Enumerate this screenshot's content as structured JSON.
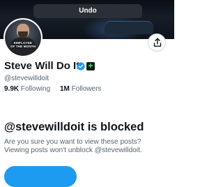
{
  "toast": {
    "undo_label": "Undo"
  },
  "profile": {
    "avatar_caption_line1": "EMPLOYEE",
    "avatar_caption_line2": "OF THE MONTH",
    "display_name": "Steve Will Do It",
    "handle": "@stevewilldoit",
    "verified_icon": "verified-check-icon",
    "affiliate_icon": "affiliate-badge-icon",
    "share_icon": "share-upload-icon",
    "accent_color": "#1d9bf0"
  },
  "stats": {
    "following_count": "9.9K",
    "following_label": "Following",
    "followers_count": "1M",
    "followers_label": "Followers"
  },
  "blocked": {
    "title": "@stevewilldoit is blocked",
    "line1": "Are you sure you want to view these posts?",
    "line2": "Viewing posts won't unblock @stevewilldoit."
  }
}
